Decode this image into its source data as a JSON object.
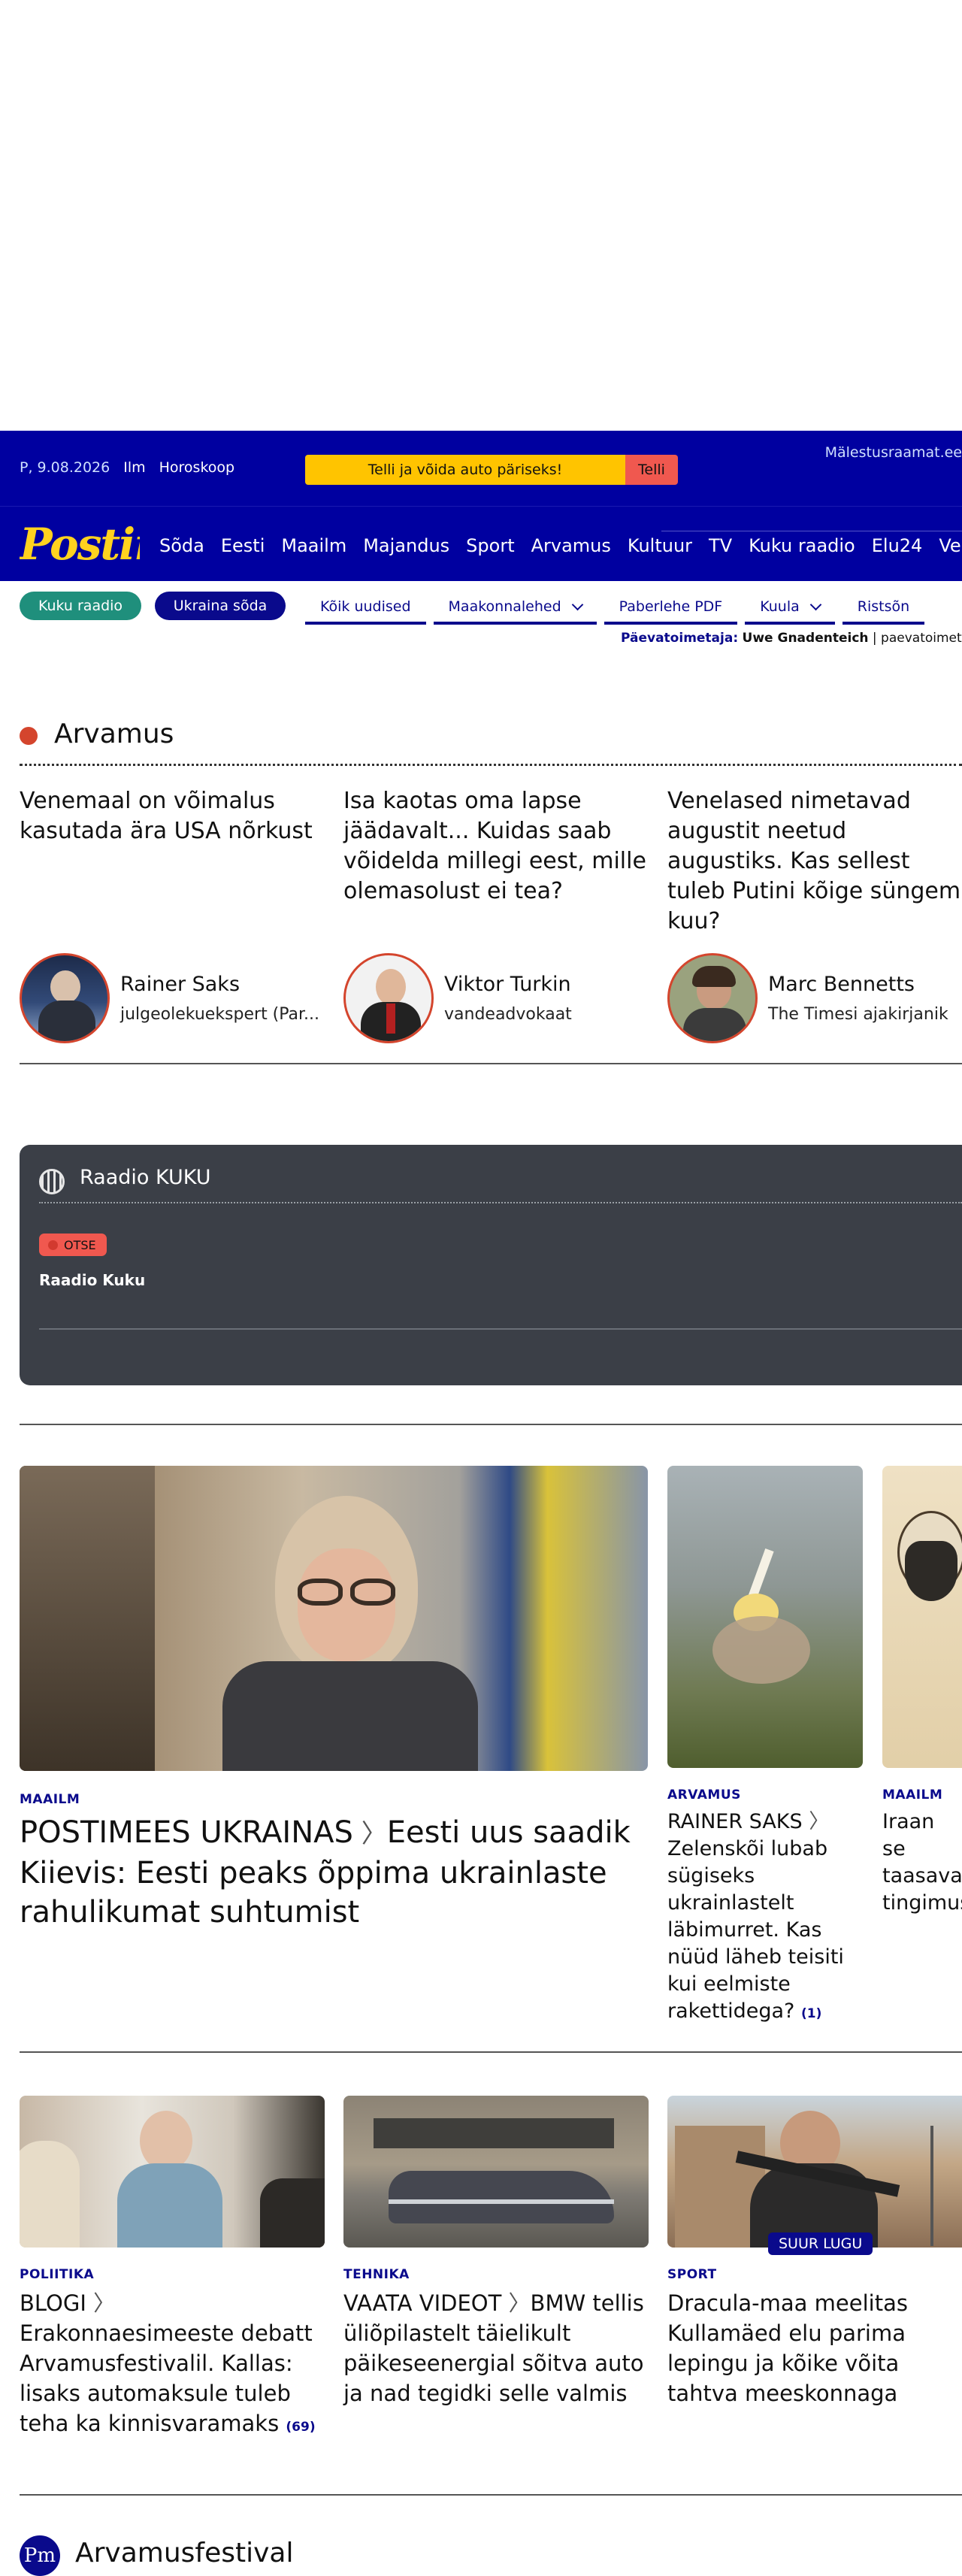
{
  "header": {
    "date": "P, 9.08.2026",
    "weather": "Ilm",
    "horoscope": "Horoskoop",
    "promo_text": "Telli ja võida auto päriseks!",
    "promo_button": "Telli",
    "malestus": "Mälestusraamat.ee",
    "logo": "Postim",
    "nav": [
      "Sõda",
      "Eesti",
      "Maailm",
      "Majandus",
      "Sport",
      "Arvamus",
      "Kultuur",
      "TV",
      "Kuku raadio",
      "Elu24",
      "Vee"
    ]
  },
  "subnav": {
    "pills": [
      "Kuku raadio",
      "Ukraina sõda"
    ],
    "tabs": [
      "Kõik uudised",
      "Maakonnalehed",
      "Paberlehe PDF",
      "Kuula",
      "Ristsõn"
    ],
    "editor_label": "Päevatoimetaja:",
    "editor_name": "Uwe Gnadenteich",
    "editor_email": "paevatoimetaja"
  },
  "arvamus": {
    "title": "Arvamus",
    "articles": [
      {
        "headline": "Venemaal on võimalus kasutada ära USA nõrkust",
        "author": "Rainer Saks",
        "role": "julgeolekuekspert (Par..."
      },
      {
        "headline": "Isa kaotas oma lapse jäädavalt... Kuidas saab võidelda millegi eest, mille olemasolust ei tea?",
        "author": "Viktor Turkin",
        "role": "vandeadvokaat"
      },
      {
        "headline": "Venelased nimetavad augustit neetud augustiks. Kas sellest tuleb Putini kõige süngem kuu?",
        "author": "Marc Bennetts",
        "role": "The Timesi ajakirjanik"
      }
    ]
  },
  "radio": {
    "title": "Raadio KUKU",
    "live": "OTSE",
    "name": "Raadio Kuku"
  },
  "news_main": {
    "category": "MAAILM",
    "kicker": "POSTIMEES UKRAINAS",
    "headline": "Eesti uus saadik Kiievis: Eesti peaks õppima ukrainlaste rahulikumat suhtumist"
  },
  "news_side": [
    {
      "category": "ARVAMUS",
      "kicker": "RAINER SAKS",
      "headline": "Zelenskõi lubab sügiseks ukrainlastelt läbimurret. Kas nüüd läheb teisiti kui eelmiste rakettidega?",
      "count": "(1)"
    },
    {
      "category": "MAAILM",
      "headline": "Iraan se taasava tingimus"
    }
  ],
  "news_row": [
    {
      "category": "POLIITIKA",
      "kicker": "BLOGI",
      "headline": "Erakonnaesimeeste debatt Arvamusfestivalil. Kallas: lisaks automaksule tuleb teha ka kinnisvaramaks",
      "count": "(69)"
    },
    {
      "category": "TEHNIKA",
      "kicker": "VAATA VIDEOT",
      "headline": "BMW tellis üliõpilastelt täielikult päikeseenergial sõitva auto ja nad tegidki selle valmis"
    },
    {
      "category": "SPORT",
      "badge": "SUUR LUGU",
      "headline": "Dracula-maa meelitas Kullamäed elu parima lepingu ja kõike võita tahtva meeskonnaga"
    }
  ],
  "festival": {
    "logo": "Pm",
    "title": "Arvamusfestival"
  },
  "colors": {
    "brand": "#0000a0",
    "accent_red": "#d4452d",
    "logo_yellow": "#ffd21f",
    "teal": "#1f8f7c"
  }
}
